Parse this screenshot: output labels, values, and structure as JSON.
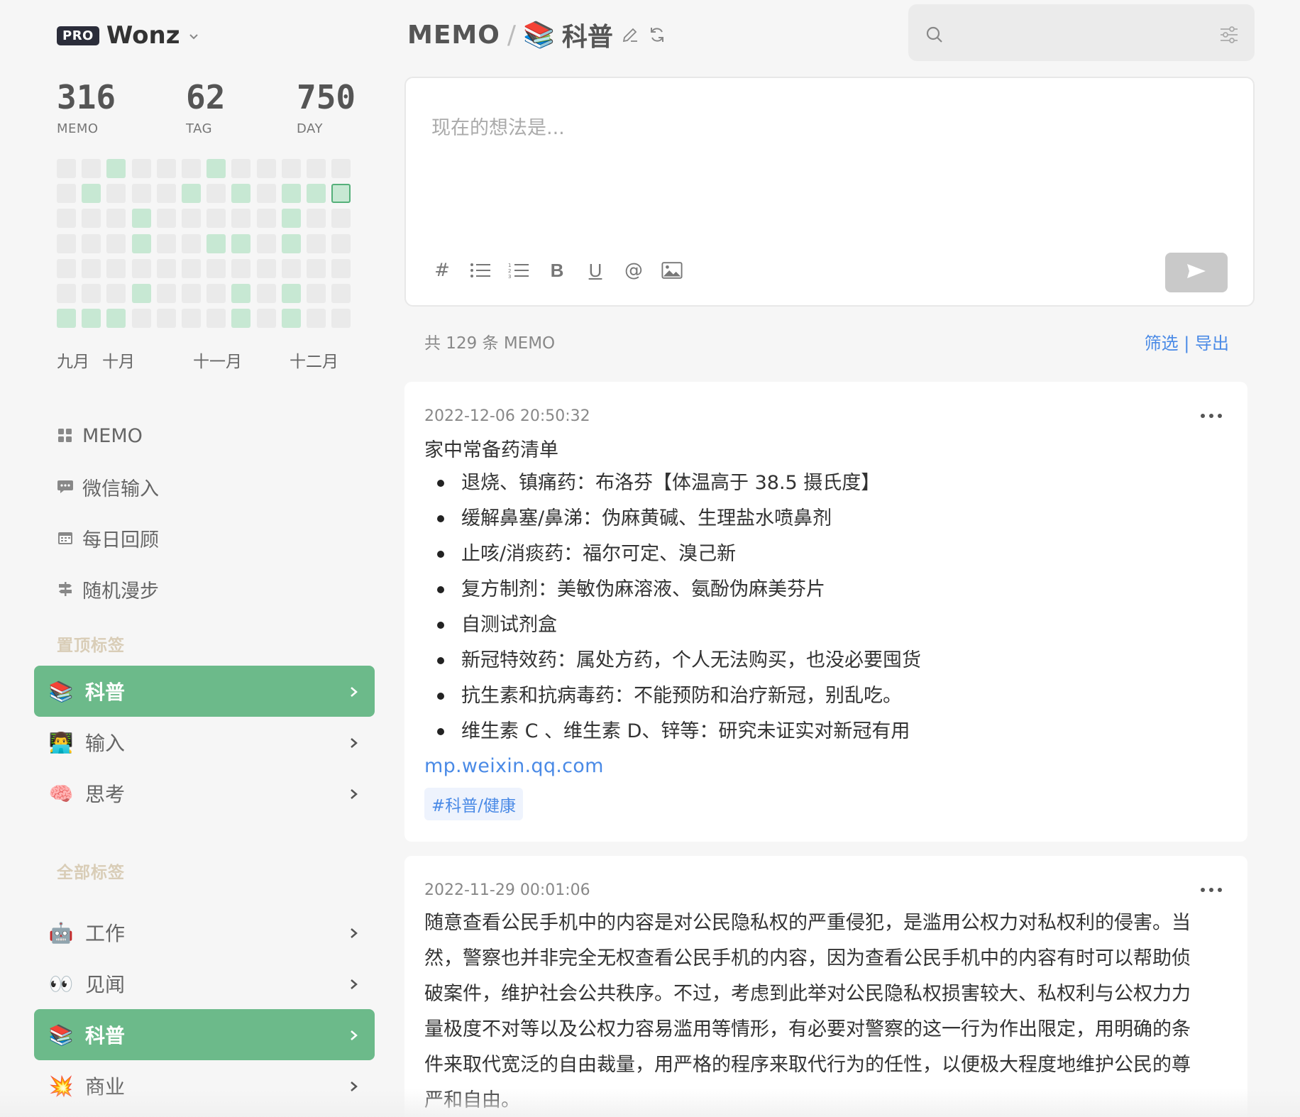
{
  "user": {
    "badge": "PRO",
    "name": "Wonz"
  },
  "stats": [
    {
      "value": "316",
      "label": "MEMO"
    },
    {
      "value": "62",
      "label": "TAG"
    },
    {
      "value": "750",
      "label": "DAY"
    }
  ],
  "heatmap": {
    "columns": 12,
    "rows": 7,
    "active_cells": [
      [
        0,
        2
      ],
      [
        0,
        6
      ],
      [
        1,
        1
      ],
      [
        1,
        5
      ],
      [
        1,
        7
      ],
      [
        1,
        9
      ],
      [
        1,
        10
      ],
      [
        2,
        3
      ],
      [
        2,
        9
      ],
      [
        3,
        3
      ],
      [
        3,
        6
      ],
      [
        3,
        7
      ],
      [
        3,
        9
      ],
      [
        5,
        3
      ],
      [
        5,
        7
      ],
      [
        5,
        9
      ],
      [
        6,
        0
      ],
      [
        6,
        1
      ],
      [
        6,
        2
      ],
      [
        6,
        7
      ],
      [
        6,
        9
      ]
    ],
    "today_cell": [
      1,
      11
    ],
    "colors": {
      "empty": "#eaeaea",
      "active": "#c7e8d3",
      "today_border": "#55b07a"
    }
  },
  "months": [
    "九月",
    "十月",
    "十一月",
    "十二月"
  ],
  "nav": [
    {
      "label": "MEMO",
      "icon": "grid-icon"
    },
    {
      "label": "微信输入",
      "icon": "chat-bubble-icon"
    },
    {
      "label": "每日回顾",
      "icon": "calendar-icon"
    },
    {
      "label": "随机漫步",
      "icon": "signpost-icon"
    }
  ],
  "pinned_section_title": "置顶标签",
  "pinned_tags": [
    {
      "emoji": "📚",
      "label": "科普",
      "active": true
    },
    {
      "emoji": "👨‍💻",
      "label": "输入",
      "active": false
    },
    {
      "emoji": "🧠",
      "label": "思考",
      "active": false
    }
  ],
  "all_section_title": "全部标签",
  "all_tags": [
    {
      "emoji": "🤖",
      "label": "工作",
      "active": false
    },
    {
      "emoji": "👀",
      "label": "见闻",
      "active": false
    },
    {
      "emoji": "📚",
      "label": "科普",
      "active": true
    },
    {
      "emoji": "💥",
      "label": "商业",
      "active": false
    }
  ],
  "header": {
    "memo": "MEMO",
    "slash": "/",
    "tag_emoji": "📚",
    "tag": "科普"
  },
  "search": {
    "placeholder": ""
  },
  "editor": {
    "placeholder": "现在的想法是..."
  },
  "toolbar": {
    "hash": "#",
    "bold": "B",
    "underline": "U",
    "at": "@"
  },
  "count": {
    "text": "共 129 条 MEMO",
    "filter": "筛选",
    "separator": " | ",
    "export": "导出"
  },
  "memos": [
    {
      "time": "2022-12-06 20:50:32",
      "title": "家中常备药清单",
      "items": [
        "退烧、镇痛药：布洛芬【体温高于 38.5 摄氏度】",
        "缓解鼻塞/鼻涕：伪麻黄碱、生理盐水喷鼻剂",
        "止咳/消痰药：福尔可定、溴己新",
        "复方制剂：美敏伪麻溶液、氨酚伪麻美芬片",
        "自测试剂盒",
        "新冠特效药：属处方药，个人无法购买，也没必要囤货",
        "抗生素和抗病毒药：不能预防和治疗新冠，别乱吃。",
        "维生素 C 、维生素 D、锌等：研究未证实对新冠有用"
      ],
      "link": "mp.weixin.qq.com",
      "tag": "#科普/健康"
    },
    {
      "time": "2022-11-29 00:01:06",
      "lines": [
        "随意查看公民手机中的内容是对公民隐私权的严重侵犯，是滥用公权力对私权利的侵害。当",
        "然，警察也并非完全无权查看公民手机的内容，因为查看公民手机中的内容有时可以帮助侦",
        "破案件，维护社会公共秩序。不过，考虑到此举对公民隐私权损害较大、私权利与公权力力",
        "量极度不对等以及公权力容易滥用等情形，有必要对警察的这一行为作出限定，用明确的条",
        "件来取代宽泛的自由裁量，用严格的程序来取代行为的任性，以便极大程度地维护公民的尊",
        "严和自由。"
      ]
    }
  ],
  "colors": {
    "accent_green": "#6cba8a",
    "link_blue": "#4a8ae6",
    "section_title": "#d9cdb7"
  }
}
